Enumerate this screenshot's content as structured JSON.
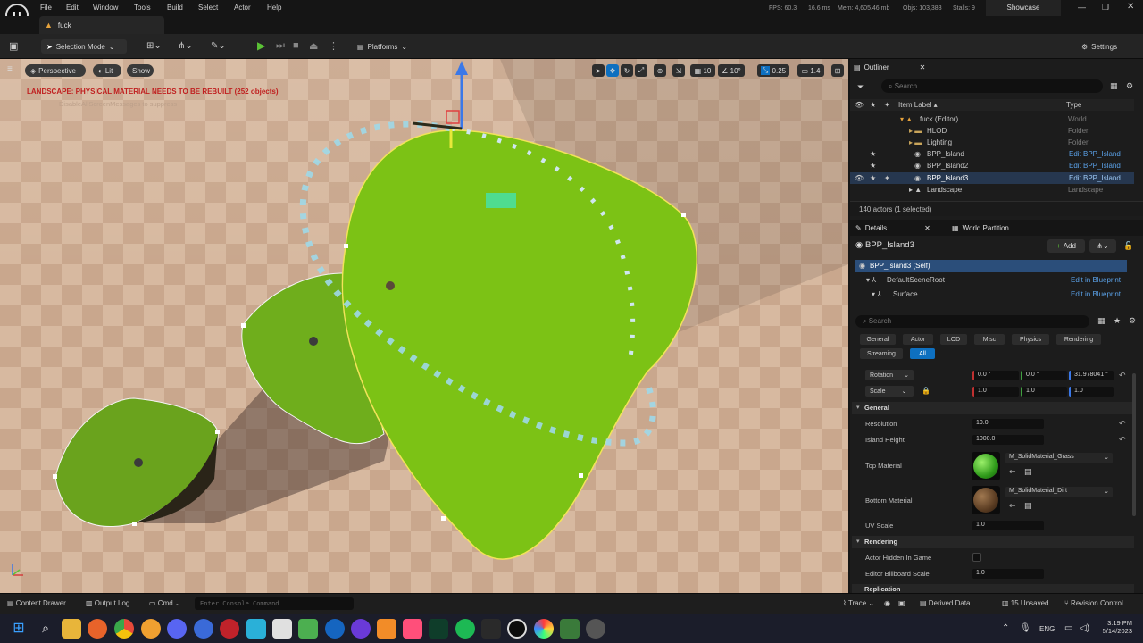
{
  "menubar": {
    "items": [
      "File",
      "Edit",
      "Window",
      "Tools",
      "Build",
      "Select",
      "Actor",
      "Help"
    ],
    "stats": {
      "fps": "FPS: 60.3",
      "ms": "16.6 ms",
      "mem": "Mem: 4,605.46 mb",
      "objs": "Objs: 103,383",
      "stalls": "Stalls: 9"
    },
    "project": "Showcase"
  },
  "tab": {
    "label": "fuck"
  },
  "toolbar": {
    "selection_mode": "Selection Mode",
    "platforms": "Platforms",
    "settings": "Settings"
  },
  "viewport": {
    "perspective": "Perspective",
    "lit": "Lit",
    "show": "Show",
    "warning": "LANDSCAPE: PHYSICAL MATERIAL NEEDS TO BE REBUILT (252 objects)",
    "warning_sub": "DisableAllScreenMessages to suppress",
    "grid": "10",
    "angle": "10°",
    "scale": "0.25",
    "cam_speed": "1.4"
  },
  "outliner": {
    "tab": "Outliner",
    "search_placeholder": "Search...",
    "col_label": "Item Label ▴",
    "col_type": "Type",
    "rows": [
      {
        "label": "fuck (Editor)",
        "type": "World",
        "link": false
      },
      {
        "label": "HLOD",
        "type": "Folder",
        "link": false
      },
      {
        "label": "Lighting",
        "type": "Folder",
        "link": false
      },
      {
        "label": "BPP_Island",
        "type": "Edit BPP_Island",
        "link": true
      },
      {
        "label": "BPP_Island2",
        "type": "Edit BPP_Island",
        "link": true
      },
      {
        "label": "BPP_Island3",
        "type": "Edit BPP_Island",
        "link": true
      },
      {
        "label": "Landscape",
        "type": "Landscape",
        "link": false
      }
    ],
    "footer": "140 actors (1 selected)"
  },
  "details": {
    "tab": "Details",
    "tab2": "World Partition",
    "actor": "BPP_Island3",
    "add": "Add",
    "components": [
      {
        "label": "BPP_Island3 (Self)",
        "action": ""
      },
      {
        "label": "DefaultSceneRoot",
        "action": "Edit in Blueprint"
      },
      {
        "label": "Surface",
        "action": "Edit in Blueprint"
      }
    ],
    "search_placeholder": "Search",
    "filters": [
      "General",
      "Actor",
      "LOD",
      "Misc",
      "Physics",
      "Rendering",
      "Streaming",
      "All"
    ],
    "rotation_label": "Rotation",
    "rotation": [
      "0.0 °",
      "0.0 °",
      "31.978041 °"
    ],
    "scale_label": "Scale",
    "scale": [
      "1.0",
      "1.0",
      "1.0"
    ],
    "section_general": "General",
    "resolution_label": "Resolution",
    "resolution": "10.0",
    "island_height_label": "Island Height",
    "island_height": "1000.0",
    "top_material_label": "Top Material",
    "top_material": "M_SolidMaterial_Grass",
    "bottom_material_label": "Bottom Material",
    "bottom_material": "M_SolidMaterial_Dirt",
    "uv_scale_label": "UV Scale",
    "uv_scale": "1.0",
    "section_rendering": "Rendering",
    "hidden_label": "Actor Hidden In Game",
    "billboard_label": "Editor Billboard Scale",
    "billboard": "1.0",
    "section_replication": "Replication"
  },
  "statusbar": {
    "content_drawer": "Content Drawer",
    "output_log": "Output Log",
    "cmd": "Cmd",
    "console_placeholder": "Enter Console Command",
    "trace": "Trace",
    "derived": "Derived Data",
    "unsaved": "15 Unsaved",
    "revision": "Revision Control"
  },
  "taskbar": {
    "lang": "ENG",
    "time": "3:19 PM",
    "date": "5/14/2023"
  },
  "colors": {
    "grass": "#7cb518",
    "accent": "#0e70c0",
    "selection": "#26374f"
  }
}
